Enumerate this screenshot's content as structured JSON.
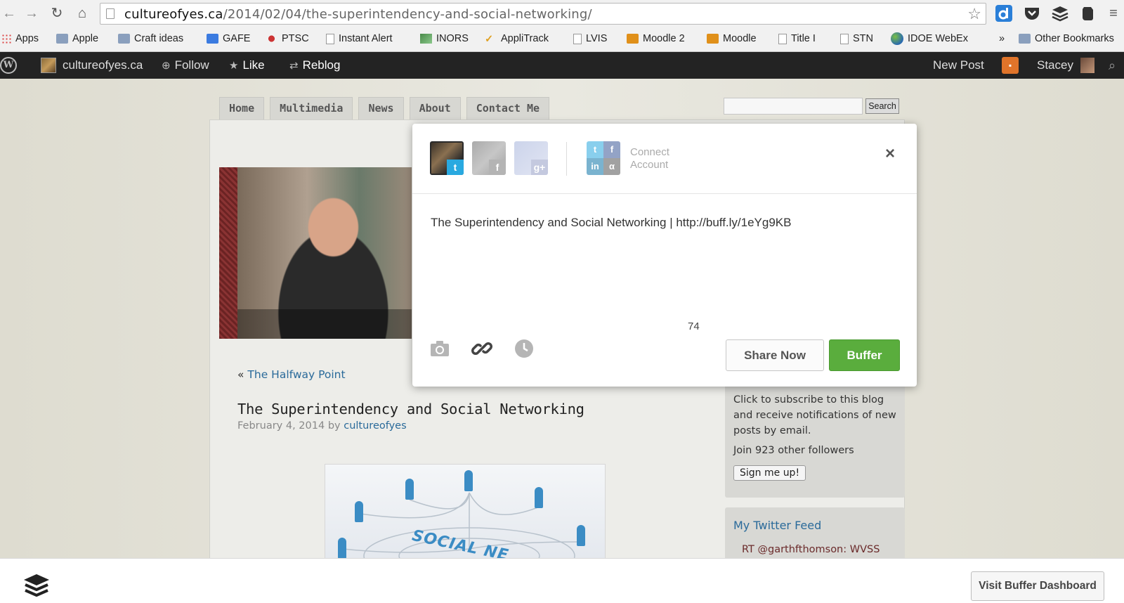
{
  "browser": {
    "url_host": "cultureofyes.ca",
    "url_path": "/2014/02/04/the-superintendency-and-social-networking/",
    "bookmarks": [
      {
        "label": "Apps"
      },
      {
        "label": "Apple"
      },
      {
        "label": "Craft ideas"
      },
      {
        "label": "GAFE"
      },
      {
        "label": "PTSC"
      },
      {
        "label": "Instant Alert"
      },
      {
        "label": "INORS"
      },
      {
        "label": "AppliTrack"
      },
      {
        "label": "LVIS"
      },
      {
        "label": "Moodle 2"
      },
      {
        "label": "Moodle"
      },
      {
        "label": "Title I"
      },
      {
        "label": "STN"
      },
      {
        "label": "IDOE WebEx"
      }
    ],
    "more_bookmarks": "»",
    "other_bookmarks": "Other Bookmarks"
  },
  "admin_bar": {
    "site_name": "cultureofyes.ca",
    "follow": "Follow",
    "like": "Like",
    "reblog": "Reblog",
    "new_post": "New Post",
    "user": "Stacey"
  },
  "blog": {
    "nav": [
      "Home",
      "Multimedia",
      "News",
      "About",
      "Contact Me"
    ],
    "search_button": "Search",
    "prev_prefix": "«",
    "prev_link": "The Halfway Point",
    "post_title": "The Superintendency and Social Networking",
    "post_date": "February 4, 2014",
    "post_by": "by",
    "post_author": "cultureofyes",
    "image_word": "SOCIAL NE...",
    "subscribe_text": "Click to subscribe to this blog and receive notifications of new posts by email.",
    "followers_text": "Join 923 other followers",
    "signup_button": "Sign me up!",
    "twitter_title": "My Twitter Feed",
    "twitter_item": "RT @garthfthomson: WVSS"
  },
  "buffer_modal": {
    "connect_label": "Connect Account",
    "close": "×",
    "message": "The Superintendency and Social Networking | http://buff.ly/1eYg9KB",
    "char_count": "74",
    "share_now": "Share Now",
    "buffer": "Buffer"
  },
  "bottom_bar": {
    "dashboard_button": "Visit Buffer Dashboard"
  },
  "colors": {
    "buffer_green": "#5aad3d",
    "twitter_blue": "#29a9e0",
    "wp_bar": "#232323",
    "link_blue": "#2a6a9a"
  }
}
